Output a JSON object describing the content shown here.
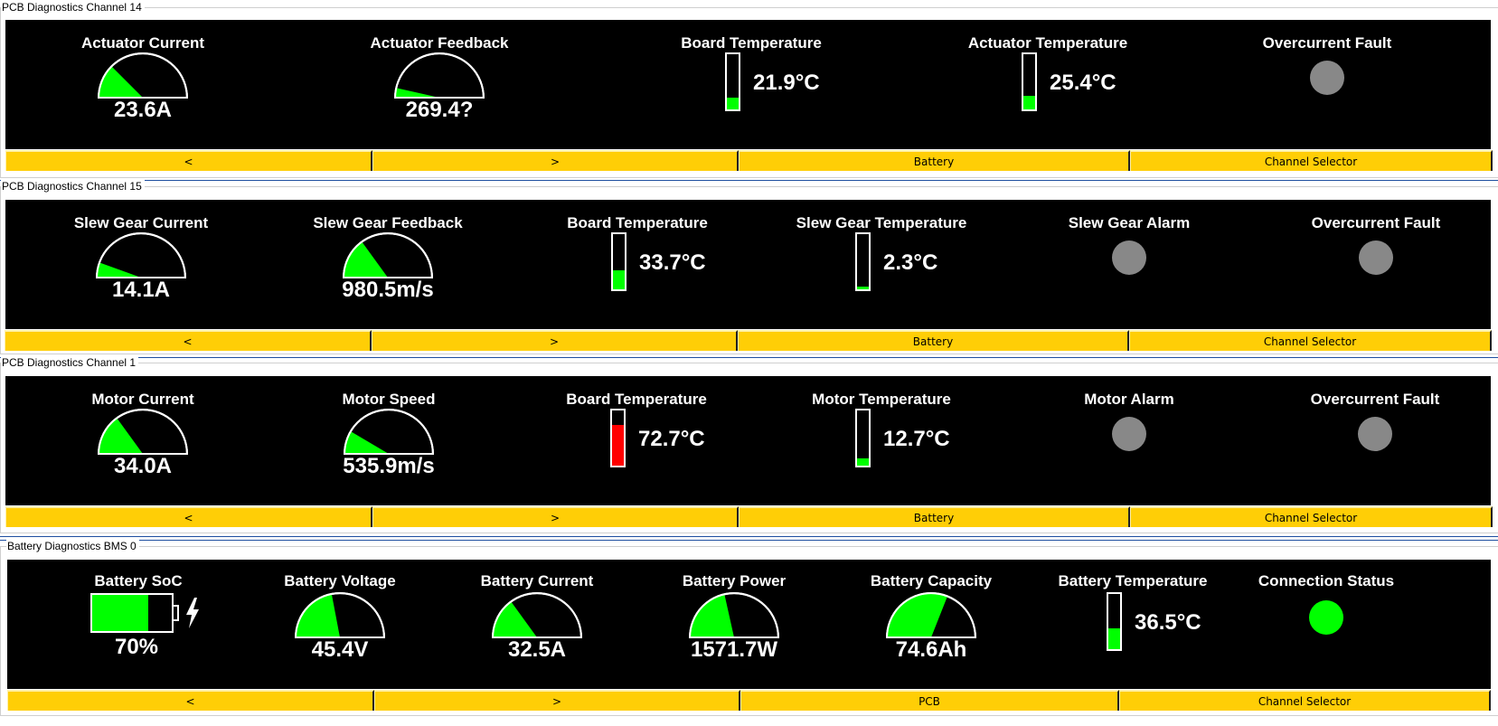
{
  "colors": {
    "panel_bg": "#000000",
    "nav_bg": "#ffce06",
    "gauge_fill": "#00ff00",
    "therm_ok": "#00ff00",
    "therm_hot": "#ff0000",
    "led_off": "#888888",
    "led_on": "#00ff00"
  },
  "groups": [
    {
      "title": "PCB Diagnostics Channel 14",
      "widgets": [
        {
          "type": "gauge",
          "label": "Actuator Current",
          "value": "23.6A",
          "level": 0.25
        },
        {
          "type": "gauge",
          "label": "Actuator Feedback",
          "value": "269.4?",
          "level": 0.07
        },
        {
          "type": "therm",
          "label": "Board Temperature",
          "value": "21.9°C",
          "level": 0.22,
          "status": "ok"
        },
        {
          "type": "therm",
          "label": "Actuator Temperature",
          "value": "25.4°C",
          "level": 0.25,
          "status": "ok"
        },
        {
          "type": "led",
          "label": "Overcurrent Fault",
          "state": "off"
        }
      ],
      "nav": [
        "<",
        ">",
        "Battery",
        "Channel Selector"
      ]
    },
    {
      "title": "PCB Diagnostics Channel 15",
      "widgets": [
        {
          "type": "gauge",
          "label": "Slew Gear Current",
          "value": "14.1A",
          "level": 0.11
        },
        {
          "type": "gauge",
          "label": "Slew Gear Feedback",
          "value": "980.5m/s",
          "level": 0.3
        },
        {
          "type": "therm",
          "label": "Board Temperature",
          "value": "33.7°C",
          "level": 0.34,
          "status": "ok"
        },
        {
          "type": "therm",
          "label": "Slew Gear Temperature",
          "value": "2.3°C",
          "level": 0.02,
          "status": "ok"
        },
        {
          "type": "led",
          "label": "Slew Gear Alarm",
          "state": "off"
        },
        {
          "type": "led",
          "label": "Overcurrent Fault",
          "state": "off"
        }
      ],
      "nav": [
        "<",
        ">",
        "Battery",
        "Channel Selector"
      ]
    },
    {
      "title": "PCB Diagnostics Channel 1",
      "widgets": [
        {
          "type": "gauge",
          "label": "Motor Current",
          "value": "34.0A",
          "level": 0.3
        },
        {
          "type": "gauge",
          "label": "Motor Speed",
          "value": "535.9m/s",
          "level": 0.17
        },
        {
          "type": "therm",
          "label": "Board Temperature",
          "value": "72.7°C",
          "level": 0.73,
          "status": "hot"
        },
        {
          "type": "therm",
          "label": "Motor Temperature",
          "value": "12.7°C",
          "level": 0.13,
          "status": "ok"
        },
        {
          "type": "led",
          "label": "Motor Alarm",
          "state": "off"
        },
        {
          "type": "led",
          "label": "Overcurrent Fault",
          "state": "off"
        }
      ],
      "nav": [
        "<",
        ">",
        "Battery",
        "Channel Selector"
      ]
    },
    {
      "title": "Battery Diagnostics BMS 0",
      "widgets": [
        {
          "type": "battery",
          "label": "Battery SoC",
          "value": "70%",
          "level": 0.7
        },
        {
          "type": "gauge",
          "label": "Battery Voltage",
          "value": "45.4V",
          "level": 0.44
        },
        {
          "type": "gauge",
          "label": "Battery Current",
          "value": "32.5A",
          "level": 0.3
        },
        {
          "type": "gauge",
          "label": "Battery Power",
          "value": "1571.7W",
          "level": 0.43
        },
        {
          "type": "gauge",
          "label": "Battery Capacity",
          "value": "74.6Ah",
          "level": 0.62
        },
        {
          "type": "therm",
          "label": "Battery Temperature",
          "value": "36.5°C",
          "level": 0.37,
          "status": "ok"
        },
        {
          "type": "led",
          "label": "Connection Status",
          "state": "on"
        }
      ],
      "nav": [
        "<",
        ">",
        "PCB",
        "Channel Selector"
      ]
    }
  ]
}
